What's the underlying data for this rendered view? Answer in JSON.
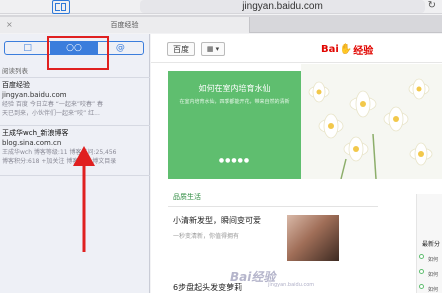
{
  "browser": {
    "url": "jingyan.baidu.com",
    "reload_icon": "reload-icon"
  },
  "tabs": [
    {
      "label": "百度经验"
    },
    {
      "label": ""
    }
  ],
  "sidebar": {
    "segments": [
      "□",
      "○○",
      "@"
    ],
    "list_title": "阅读列表",
    "items": [
      {
        "title": "百度经验",
        "domain": "jingyan.baidu.com",
        "snippet1": "经验 百度 今日立春 “一起来”咬春” 春",
        "snippet2": "天已到来，小伙伴们一起来“咬” 红..."
      },
      {
        "title": "王成华wch_新浪博客",
        "domain": "blog.sina.com.cn",
        "snippet1": "王成华wch 博客等级:11 博客访问:25,456",
        "snippet2": "博客积分:618 +加关注 博客介绍 博文目录"
      }
    ]
  },
  "main": {
    "baidu_button": "百度",
    "menu_button_icon": "grid-icon",
    "logo_bai": "Bai",
    "logo_paw": "du",
    "logo_jy": "经验",
    "banner": {
      "title": "如何在室内培育水仙",
      "subtitle": "在室内培育水仙，四季都能开花，带来自然的清新",
      "dots": "●●●●●"
    },
    "section_title": "品质生活",
    "article1": {
      "title": "小清新发型，瞬间变可爱",
      "sub": "一秒变清新，你值得拥有"
    },
    "article2": {
      "title": "6步盘起头发变萝莉"
    },
    "right_col": {
      "title": "最新分",
      "links": [
        "如何",
        "如何",
        "如何"
      ]
    }
  },
  "watermark": {
    "text": "Bai经验",
    "sub": "jingyan.baidu.com"
  },
  "colors": {
    "accent_blue": "#3b7ddc",
    "highlight_red": "#e02020",
    "baidu_red": "#e10601",
    "banner_green": "#5fbe6f"
  }
}
